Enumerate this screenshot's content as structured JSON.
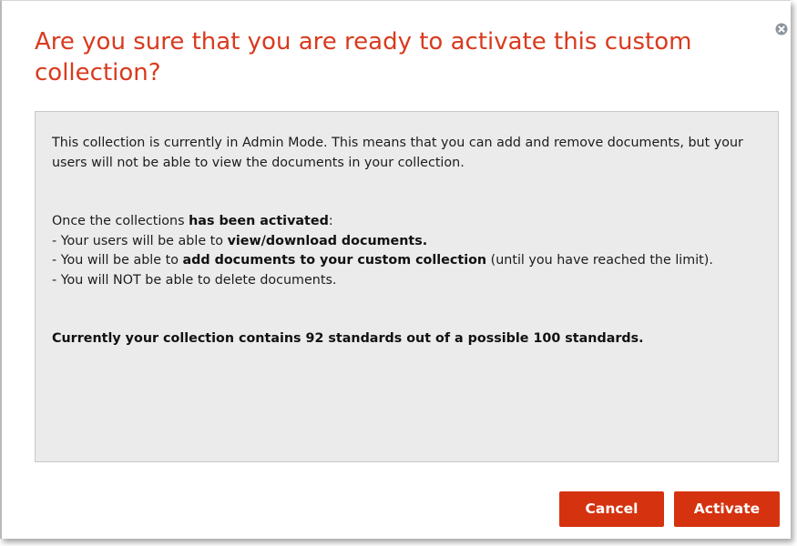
{
  "dialog": {
    "title": "Are you sure that you are ready to activate this custom collection?",
    "close_icon": "close-circle-icon",
    "colors": {
      "title": "#d93a1e",
      "button_bg": "#d5320f",
      "message_bg": "#ebebeb"
    },
    "message": {
      "intro": "This collection is currently in Admin Mode. This means that you can add and remove documents, but your users will not be able to view the documents in your collection.",
      "once_prefix": "Once the collections ",
      "once_bold": "has been activated",
      "once_suffix": ":",
      "bullet1_prefix": "- Your users will be able to ",
      "bullet1_bold": "view/download documents.",
      "bullet2_prefix": "- You will be able to ",
      "bullet2_bold": "add documents to your custom collection",
      "bullet2_suffix": " (until you have reached the limit).",
      "bullet3": "- You will NOT be able to delete documents.",
      "summary": "Currently your collection contains 92 standards out of a possible 100 standards."
    },
    "buttons": {
      "cancel": "Cancel",
      "activate": "Activate"
    }
  }
}
